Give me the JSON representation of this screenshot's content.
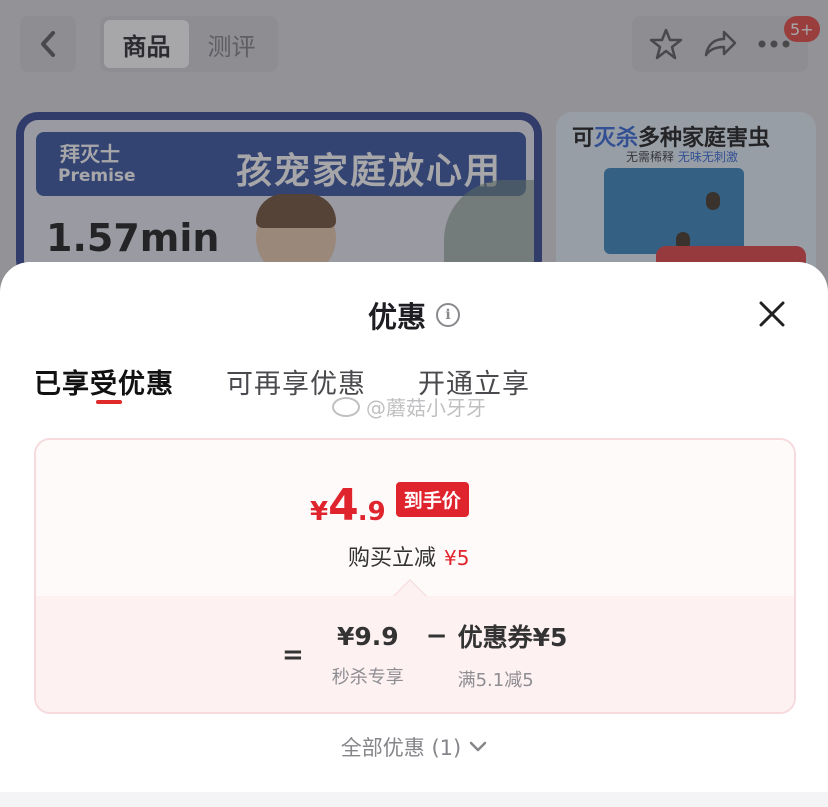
{
  "nav": {
    "tabs": [
      {
        "label": "商品",
        "active": true
      },
      {
        "label": "测评",
        "active": false
      }
    ],
    "badge": "5+",
    "icons": [
      "back-chevron-icon",
      "star-icon",
      "share-icon",
      "more-icon"
    ]
  },
  "banner1": {
    "brand_cn": "拜灭士",
    "brand_en": "Premise",
    "slogan": "孩宠家庭放心用",
    "timer": "1.57min"
  },
  "banner2": {
    "title_prefix": "可",
    "title_highlight": "灭杀",
    "title_suffix": "多种家庭害虫",
    "sub_plain": "无需稀释",
    "sub_highlight": "无味无刺激"
  },
  "sheet": {
    "title": "优惠",
    "tabs": [
      {
        "label": "已享受优惠",
        "active": true
      },
      {
        "label": "可再享优惠",
        "active": false
      },
      {
        "label": "开通立享",
        "active": false
      }
    ],
    "watermark": "@蘑菇小牙牙",
    "final_price": {
      "currency": "¥",
      "integer": "4",
      "decimal": ".9",
      "tag": "到手价"
    },
    "instant_discount": {
      "label": "购买立减",
      "amount": "¥5"
    },
    "breakdown": {
      "equals": "=",
      "minus": "−",
      "flash_price": "¥9.9",
      "flash_label": "秒杀专享",
      "coupon": "优惠券¥5",
      "coupon_rule": "满5.1减5"
    },
    "all_discounts": "全部优惠 (1)"
  },
  "colors": {
    "accent_red": "#e0242e",
    "card_border": "#f6dadd",
    "card_bottom_bg": "#fdf1f2"
  }
}
